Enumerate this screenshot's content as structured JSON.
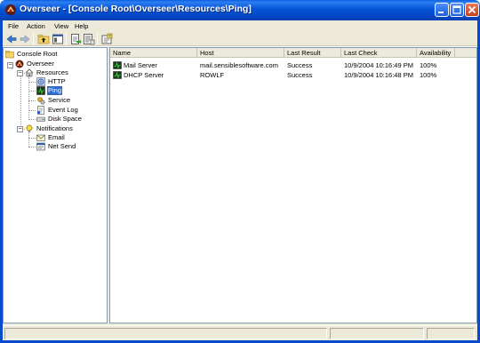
{
  "window": {
    "title": "Overseer - [Console Root\\Overseer\\Resources\\Ping]"
  },
  "menu": {
    "items": [
      "File",
      "Action",
      "View",
      "Help"
    ]
  },
  "toolbar": {
    "buttons": [
      "back-icon",
      "forward-icon",
      "up-folder-icon",
      "show-tree-icon",
      "export-icon",
      "list-icon",
      "properties-icon"
    ]
  },
  "tree": {
    "root": "Console Root",
    "overseer": "Overseer",
    "resources": "Resources",
    "http": "HTTP",
    "ping": "Ping",
    "service": "Service",
    "eventlog": "Event Log",
    "diskspace": "Disk Space",
    "notifications": "Notifications",
    "email": "Email",
    "netsend": "Net Send"
  },
  "list": {
    "columns": [
      "Name",
      "Host",
      "Last Result",
      "Last Check",
      "Availability"
    ],
    "rows": [
      [
        "Mail Server",
        "mail.sensiblesoftware.com",
        "Success",
        "10/9/2004 10:16:49 PM",
        "100%"
      ],
      [
        "DHCP Server",
        "ROWLF",
        "Success",
        "10/9/2004 10:16:48 PM",
        "100%"
      ]
    ]
  },
  "colors": {
    "titlebar": "#0554d6",
    "selection": "#316ac5",
    "chrome": "#ece9d8"
  }
}
